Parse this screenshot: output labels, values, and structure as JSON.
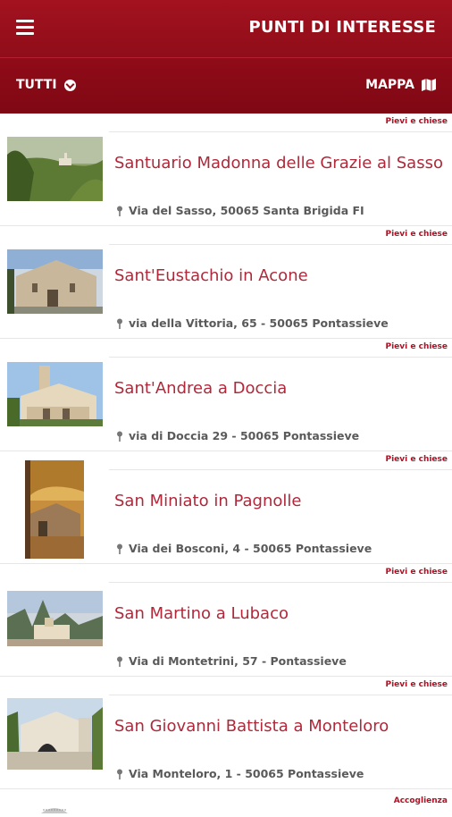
{
  "header": {
    "title": "PUNTI DI INTERESSE",
    "menu_icon": "hamburger-menu-icon"
  },
  "filterbar": {
    "filter_label": "TUTTI",
    "filter_icon": "chevron-down-circle-icon",
    "map_label": "MAPPA",
    "map_icon": "map-icon"
  },
  "items": [
    {
      "category": "Pievi e chiese",
      "name": "Santuario Madonna delle Grazie al Sasso",
      "address": "Via del Sasso, 50065 Santa Brigida FI"
    },
    {
      "category": "Pievi e chiese",
      "name": "Sant'Eustachio in Acone",
      "address": "via della Vittoria, 65 - 50065 Pontassieve"
    },
    {
      "category": "Pievi e chiese",
      "name": "Sant'Andrea a Doccia",
      "address": "via di Doccia 29 - 50065 Pontassieve"
    },
    {
      "category": "Pievi e chiese",
      "name": "San Miniato in Pagnolle",
      "address": "Via dei Bosconi, 4 - 50065 Pontassieve"
    },
    {
      "category": "Pievi e chiese",
      "name": "San Martino a Lubaco",
      "address": "Via di Montetrini, 57 - Pontassieve"
    },
    {
      "category": "Pievi e chiese",
      "name": "San Giovanni Battista a Monteloro",
      "address": "Via Monteloro, 1 - 50065 Pontassieve"
    }
  ],
  "partial_item": {
    "category": "Accoglienza"
  },
  "colors": {
    "primary": "#a3121f",
    "accent_text": "#b0283a"
  }
}
